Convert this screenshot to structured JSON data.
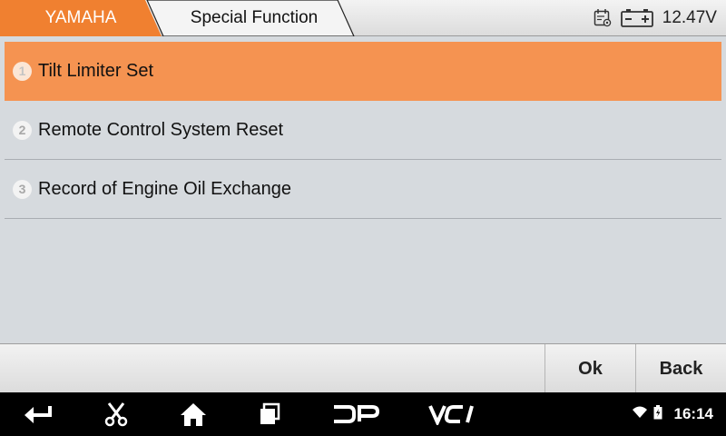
{
  "header": {
    "brand": "YAMAHA",
    "function": "Special Function",
    "calendar_icon": "calendar-settings-icon",
    "battery_icon": "battery-icon",
    "voltage": "12.47V"
  },
  "menu": {
    "items": [
      {
        "number": "1",
        "label": "Tilt Limiter Set",
        "selected": true
      },
      {
        "number": "2",
        "label": "Remote Control System Reset",
        "selected": false
      },
      {
        "number": "3",
        "label": "Record of Engine Oil Exchange",
        "selected": false
      }
    ]
  },
  "actions": {
    "ok_label": "Ok",
    "back_label": "Back"
  },
  "navbar": {
    "icons": [
      "back-arrow-icon",
      "scissors-icon",
      "home-icon",
      "recent-apps-icon",
      "dp-icon",
      "vci-icon"
    ],
    "dp_text": "DP",
    "vci_text": "VCI",
    "time": "16:14"
  },
  "colors": {
    "accent": "#f59351",
    "brand_tab": "#f08030",
    "list_bg": "#d6dade"
  }
}
